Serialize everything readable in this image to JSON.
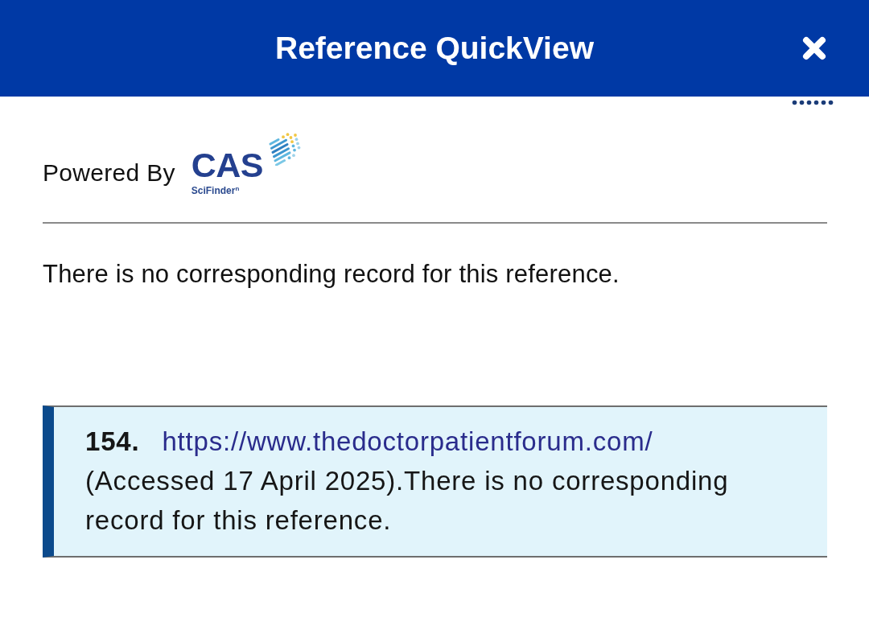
{
  "header": {
    "title": "Reference QuickView"
  },
  "branding": {
    "label": "Powered By",
    "logo_wordmark": "CAS",
    "logo_product": "SciFinder$^{n}$"
  },
  "message": "There is no corresponding record for this reference.",
  "reference": {
    "number": "154.",
    "link": "https://www.thedoctorpatientforum.com/",
    "text": "(Accessed 17 April 2025).There is no corresponding record for this reference."
  }
}
